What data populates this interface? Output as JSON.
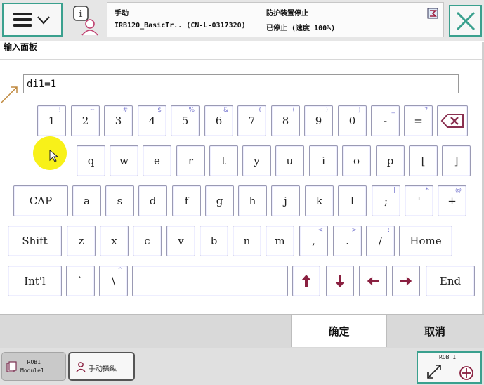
{
  "header": {
    "mode": "手动",
    "robot_info": "IRB120_BasicTr.. (CN-L-0317320)",
    "safety_state": "防护装置停止",
    "run_status": "已停止 (速度 100%)",
    "panel_title": "输入面板"
  },
  "input": {
    "value": "di1=1"
  },
  "keyboard": {
    "row1": [
      {
        "label": "1",
        "shift": "!"
      },
      {
        "label": "2",
        "shift": "~"
      },
      {
        "label": "3",
        "shift": "#"
      },
      {
        "label": "4",
        "shift": "$"
      },
      {
        "label": "5",
        "shift": "%"
      },
      {
        "label": "6",
        "shift": "&"
      },
      {
        "label": "7",
        "shift": "("
      },
      {
        "label": "8",
        "shift": "("
      },
      {
        "label": "9",
        "shift": ")"
      },
      {
        "label": "0",
        "shift": "}"
      },
      {
        "label": "-",
        "shift": "_"
      },
      {
        "label": "=",
        "shift": "?"
      }
    ],
    "row2": [
      {
        "label": "q"
      },
      {
        "label": "w"
      },
      {
        "label": "e"
      },
      {
        "label": "r"
      },
      {
        "label": "t"
      },
      {
        "label": "y"
      },
      {
        "label": "u"
      },
      {
        "label": "i"
      },
      {
        "label": "o"
      },
      {
        "label": "p"
      },
      {
        "label": "["
      },
      {
        "label": "]"
      }
    ],
    "row3": [
      {
        "label": "a"
      },
      {
        "label": "s"
      },
      {
        "label": "d"
      },
      {
        "label": "f"
      },
      {
        "label": "g"
      },
      {
        "label": "h"
      },
      {
        "label": "j"
      },
      {
        "label": "k"
      },
      {
        "label": "l"
      },
      {
        "label": ";",
        "shift": "|"
      },
      {
        "label": "'",
        "shift": "*"
      },
      {
        "label": "+",
        "shift": "@"
      }
    ],
    "row4": [
      {
        "label": "z"
      },
      {
        "label": "x"
      },
      {
        "label": "c"
      },
      {
        "label": "v"
      },
      {
        "label": "b"
      },
      {
        "label": "n"
      },
      {
        "label": "m"
      },
      {
        "label": ",",
        "shift": "<"
      },
      {
        "label": ".",
        "shift": ">"
      },
      {
        "label": "/",
        "shift": ":"
      }
    ],
    "row5": [
      {
        "label": "`"
      },
      {
        "label": "\\",
        "shift": "^"
      }
    ],
    "cap_label": "CAP",
    "shift_label": "Shift",
    "intl_label": "Int'l",
    "home_label": "Home",
    "end_label": "End"
  },
  "actions": {
    "confirm": "确定",
    "cancel": "取消"
  },
  "taskbar": {
    "task_line1": "T_ROB1",
    "task_line2": "Module1",
    "jog_label": "手动操纵",
    "quickset_label": "ROB_1"
  },
  "colors": {
    "accent": "#3aa08e",
    "key_border": "#9a9ab4",
    "shift_char": "#7a7ad0"
  }
}
